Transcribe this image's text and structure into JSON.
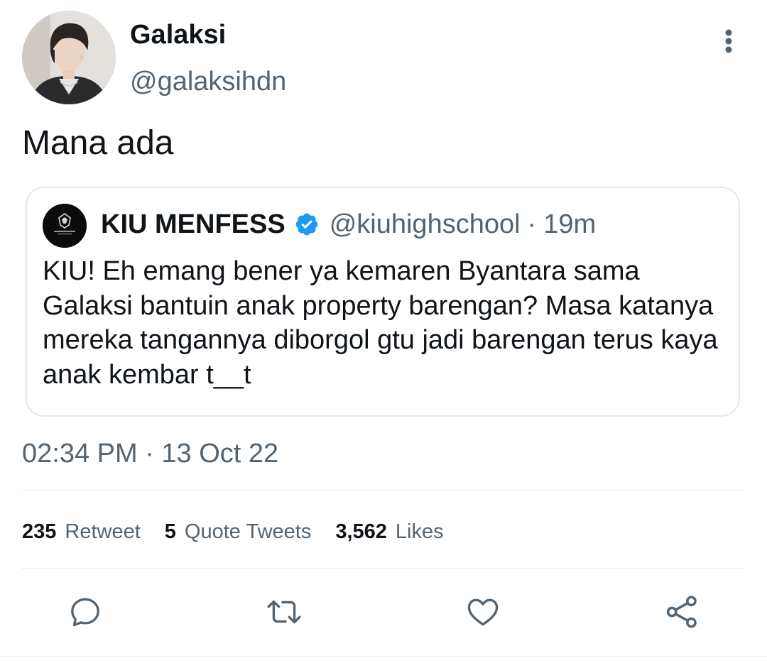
{
  "tweet": {
    "author": {
      "name": "Galaksi",
      "handle": "@galaksihdn"
    },
    "text": "Mana ada",
    "timestamp": "02:34 PM · 13 Oct 22"
  },
  "quoted_tweet": {
    "author": {
      "name": "KIU MENFESS",
      "handle": "@kiuhighschool",
      "verified": true
    },
    "separator": "·",
    "time": "19m",
    "text": "KIU! Eh emang bener ya kemaren Byantara sama Galaksi bantuin anak property barengan? Masa katanya mereka tangannya diborgol gtu jadi barengan terus kaya anak kembar t__t"
  },
  "stats": {
    "retweets_count": "235",
    "retweets_label": "Retweet",
    "quotes_count": "5",
    "quotes_label": "Quote Tweets",
    "likes_count": "3,562",
    "likes_label": "Likes"
  },
  "actions": [
    "reply-icon",
    "retweet-icon",
    "like-icon",
    "share-icon"
  ],
  "colors": {
    "text_primary": "#0f1419",
    "text_secondary": "#536471",
    "verified_blue": "#1d9bf0",
    "border": "#e1e8ed",
    "icon": "#536471"
  }
}
